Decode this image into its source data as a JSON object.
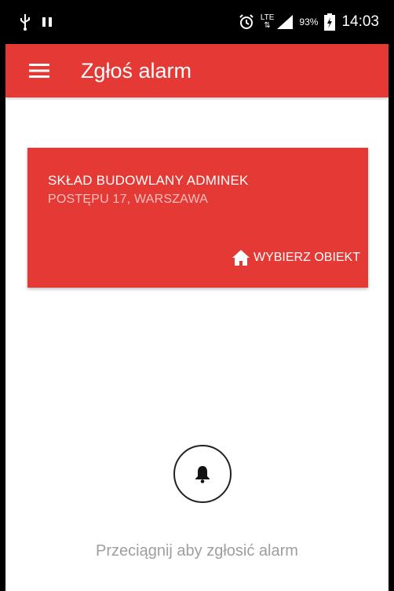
{
  "status_bar": {
    "lte_label": "LTE",
    "battery_percent": "93%",
    "time": "14:03",
    "icons": [
      "usb-icon",
      "pause-icon",
      "alarm-clock-icon",
      "lte-icon",
      "signal-icon",
      "battery-charging-icon"
    ]
  },
  "app_bar": {
    "title": "Zgłoś alarm",
    "menu_icon": "hamburger-menu-icon",
    "color": "#e53935"
  },
  "object_card": {
    "name": "SKŁAD BUDOWLANY ADMINEK",
    "address": "POSTĘPU 17,  WARSZAWA",
    "button_label": "WYBIERZ OBIEKT",
    "button_icon": "home-icon"
  },
  "alarm": {
    "icon": "bell-icon",
    "hint": "Przeciągnij aby zgłosić alarm"
  },
  "colors": {
    "accent": "#e53935",
    "hint_text": "#9e9e9e"
  }
}
